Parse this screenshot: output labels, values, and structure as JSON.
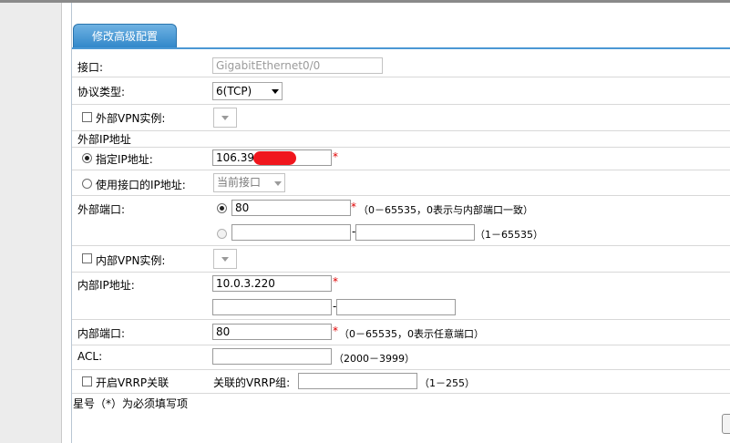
{
  "tab": {
    "label": "修改高级配置"
  },
  "form": {
    "interface": {
      "label": "接口:",
      "value": "GigabitEthernet0/0"
    },
    "protocol": {
      "label": "协议类型:",
      "selected": "6(TCP)"
    },
    "ext_vpn": {
      "label": "外部VPN实例:",
      "checked": false
    },
    "ext_ip_section": {
      "label": "外部IP地址"
    },
    "specify_ip": {
      "label": "指定IP地址:",
      "value": "106.39.",
      "required_mark": "*",
      "selected": true
    },
    "use_iface_ip": {
      "label": "使用接口的IP地址:",
      "selected_value": "当前接口",
      "selected": false
    },
    "ext_port": {
      "label": "外部端口:",
      "single_value": "80",
      "required_mark": "*",
      "single_hint": "（0－65535，0表示与内部端口一致）",
      "range_start": "",
      "range_sep": "-",
      "range_end": "",
      "range_hint": "（1－65535）"
    },
    "int_vpn": {
      "label": "内部VPN实例:",
      "checked": false
    },
    "int_ip": {
      "label": "内部IP地址:",
      "value": "10.0.3.220",
      "required_mark": "*",
      "range_start": "",
      "range_sep": "-",
      "range_end": ""
    },
    "int_port": {
      "label": "内部端口:",
      "value": "80",
      "required_mark": "*",
      "hint": "（0－65535，0表示任意端口）"
    },
    "acl": {
      "label": "ACL:",
      "value": "",
      "hint": "（2000－3999）"
    },
    "vrrp": {
      "label": "开启VRRP关联",
      "checked": false,
      "group_label": "关联的VRRP组:",
      "group_value": "",
      "hint": "（1－255）"
    }
  },
  "footer_note": "星号（*）为必须填写项",
  "colors": {
    "tab_top": "#6fb2e3",
    "tab_bottom": "#2f86c9",
    "required": "#e00000",
    "redaction": "#f0161d"
  }
}
